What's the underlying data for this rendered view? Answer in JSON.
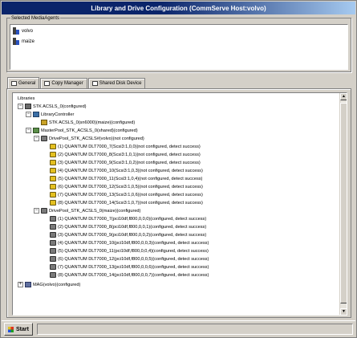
{
  "window": {
    "title": "Library and Drive Configuration (CommServe Host:volvo)"
  },
  "agents": {
    "label": "Selected MediaAgents",
    "items": [
      "volvo",
      "maize"
    ]
  },
  "tabs": [
    "General",
    "Copy Manager",
    "Shared Disk Device"
  ],
  "tree": {
    "root": "Libraries",
    "library": "STK ACSLS_0(configured)",
    "controller_group": "LibraryController",
    "controller": "STK ACSLS_0(sn6000)(maize)(configured)",
    "masterpool": "MasterPool_STK_ACSLS_0(shared)(configured)",
    "pool1": "DrivePool_STK_ACSLS#(volvo)(not configured)",
    "pool1_drives": [
      "(1) QUANTUM DLT7000_7(Scsi3:1,0,0)(not configured, detect success)",
      "(2) QUANTUM DLT7000_8(Scsi3:1,0,1)(not configured, detect success)",
      "(3) QUANTUM DLT7000_9(Scsi3:1,0,2)(not configured, detect success)",
      "(4) QUANTUM DLT7000_10(Scsi3:1,0,3)(not configured, detect success)",
      "(5) QUANTUM DLT7000_11(Scsi3:1,0,4)(not configured, detect success)",
      "(6) QUANTUM DLT7000_12(Scsi3:1,0,5)(not configured, detect success)",
      "(7) QUANTUM DLT7000_13(Scsi3:1,0,6)(not configured, detect success)",
      "(8) QUANTUM DLT7000_14(Scsi3:1,0,7)(not configured, detect success)"
    ],
    "pool2": "DrivePool_STK_ACSLS_0(maize)(configured)",
    "pool2_drives": [
      "(1) QUANTUM DLT7000_7(pci10df,f800,0,0,0)(configured, detect success)",
      "(2) QUANTUM DLT7000_8(pci10df,f800,0,0,1)(configured, detect success)",
      "(3) QUANTUM DLT7000_9(pci10df,f800,0,0,2)(configured, detect success)",
      "(4) QUANTUM DLT7000_10(pci10df,f800,0,0,3)(configured, detect success)",
      "(5) QUANTUM DLT7000_11(pci10df,f800,0,0,4)(configured, detect success)",
      "(6) QUANTUM DLT7000_12(pci10df,f800,0,0,5)(configured, detect success)",
      "(7) QUANTUM DLT7000_13(pci10df,f800,0,0,6)(configured, detect success)",
      "(8) QUANTUM DLT7000_14(pci10df,f800,0,0,7)(configured, detect success)"
    ],
    "mag": "MAG(volvo)(configured)"
  },
  "taskbar": {
    "start_label": "Start"
  }
}
